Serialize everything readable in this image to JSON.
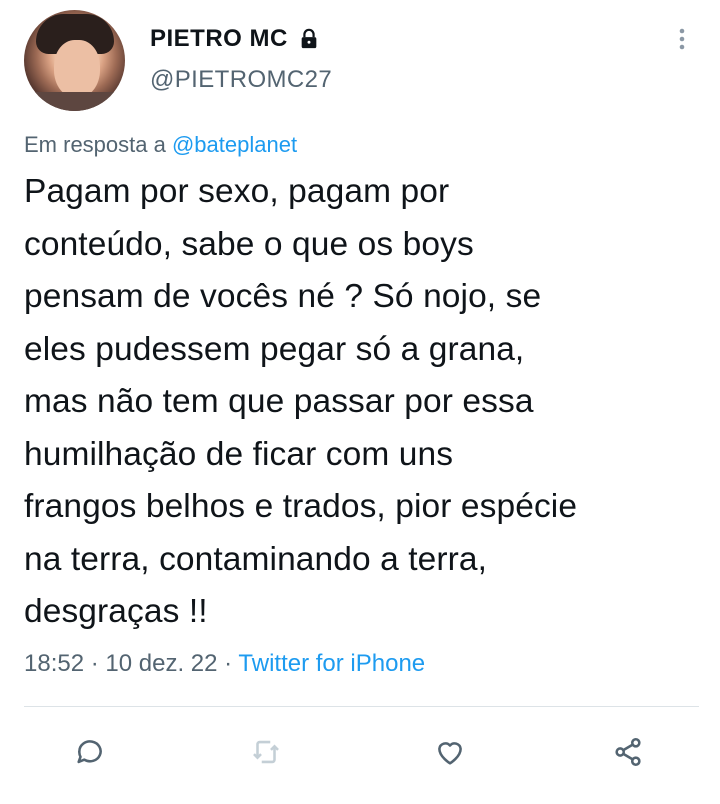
{
  "tweet": {
    "display_name": "PIETRO MC",
    "handle": "@PIETROMC27",
    "reply_prefix": "Em resposta a",
    "reply_mention": "@bateplanet",
    "text_lines": [
      "Pagam por sexo, pagam por",
      "conteúdo, sabe o que os boys",
      "pensam de vocês né ? Só nojo, se",
      "eles pudessem pegar só a grana,",
      "mas não tem que passar por essa",
      "humilhação de ficar com uns",
      "frangos belhos e trados, pior espécie",
      "na terra, contaminando a terra,",
      "desgraças !!"
    ],
    "time": "18:52",
    "date": "10 dez. 22",
    "separator": "·",
    "source": "Twitter for iPhone"
  },
  "icons": {
    "protected": "lock-icon",
    "more": "more-vertical-icon",
    "reply": "reply-icon",
    "retweet": "retweet-icon",
    "like": "heart-icon",
    "share": "share-icon"
  },
  "colors": {
    "text": "#0f1419",
    "secondary": "#536471",
    "link": "#1d9bf0",
    "icon": "#536471",
    "retweet_disabled": "#c4cfd6",
    "divider": "#dde3e7"
  }
}
